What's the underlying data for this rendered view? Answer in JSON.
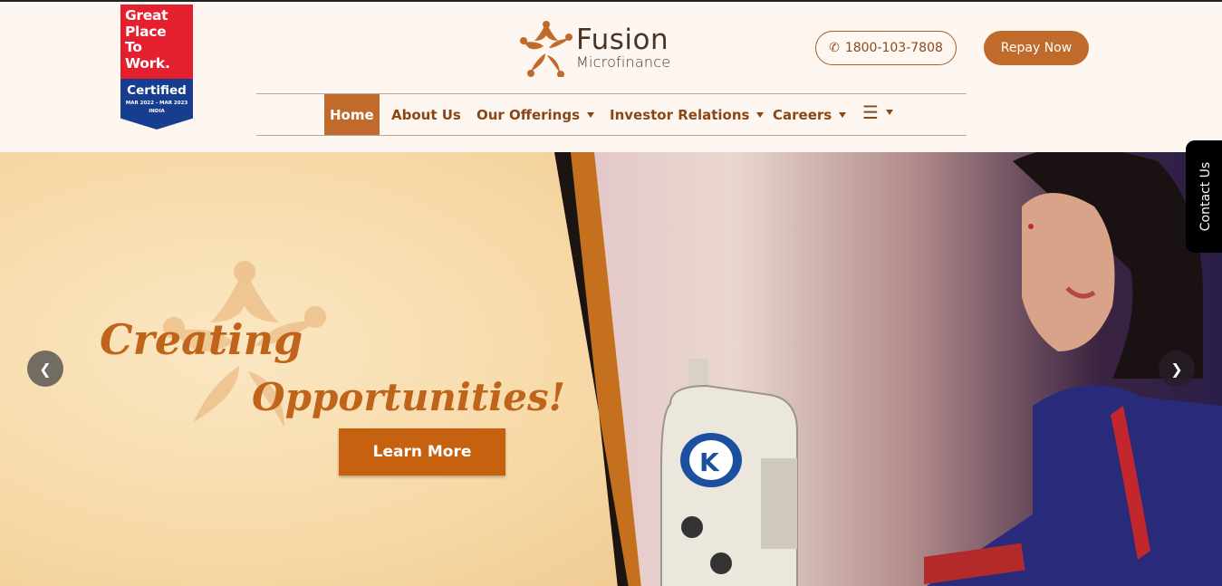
{
  "badge": {
    "lines": [
      "Great",
      "Place",
      "To",
      "Work."
    ],
    "certified": "Certified",
    "period": "MAR 2022 - MAR 2023",
    "country": "INDIA"
  },
  "logo": {
    "brand": "Fusion",
    "sub": "Microfinance"
  },
  "header": {
    "phone_icon": "phone-icon",
    "phone": "1800-103-7808",
    "repay": "Repay Now"
  },
  "nav": {
    "items": [
      {
        "label": "Home",
        "active": true
      },
      {
        "label": "About Us"
      },
      {
        "label": "Our Offerings",
        "dropdown": true
      },
      {
        "label": "Investor Relations",
        "dropdown": true
      },
      {
        "label": "Careers",
        "dropdown": true
      }
    ],
    "more_icon": "hamburger-icon"
  },
  "hero": {
    "line1": "Creating",
    "line2": "Opportunities!",
    "cta": "Learn More",
    "prev_icon": "chevron-left-icon",
    "next_icon": "chevron-right-icon"
  },
  "contact_tab": "Contact Us",
  "colors": {
    "brand": "#c06a2c",
    "nav_text": "#8a4716",
    "badge_red": "#e4202f",
    "badge_blue": "#173d8e"
  }
}
